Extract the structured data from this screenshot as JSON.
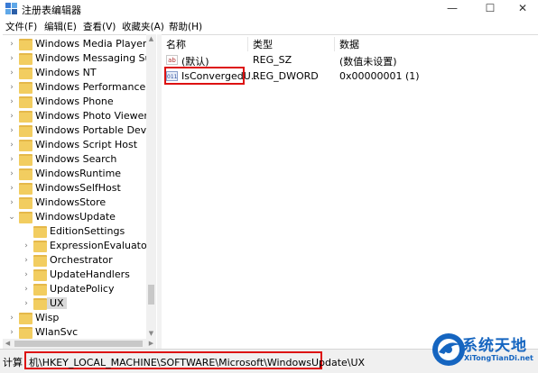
{
  "window": {
    "title": "注册表编辑器",
    "minimize_glyph": "—",
    "maximize_glyph": "☐",
    "close_glyph": "✕"
  },
  "menu": [
    "文件(F)",
    "编辑(E)",
    "查看(V)",
    "收藏夹(A)",
    "帮助(H)"
  ],
  "tree": [
    {
      "label": "Windows Media Player NS",
      "indent": 0,
      "expander": "collapsed"
    },
    {
      "label": "Windows Messaging Subs",
      "indent": 0,
      "expander": "collapsed"
    },
    {
      "label": "Windows NT",
      "indent": 0,
      "expander": "collapsed"
    },
    {
      "label": "Windows Performance Too",
      "indent": 0,
      "expander": "collapsed"
    },
    {
      "label": "Windows Phone",
      "indent": 0,
      "expander": "collapsed"
    },
    {
      "label": "Windows Photo Viewer",
      "indent": 0,
      "expander": "collapsed"
    },
    {
      "label": "Windows Portable Devices",
      "indent": 0,
      "expander": "collapsed"
    },
    {
      "label": "Windows Script Host",
      "indent": 0,
      "expander": "collapsed"
    },
    {
      "label": "Windows Search",
      "indent": 0,
      "expander": "collapsed"
    },
    {
      "label": "WindowsRuntime",
      "indent": 0,
      "expander": "collapsed"
    },
    {
      "label": "WindowsSelfHost",
      "indent": 0,
      "expander": "collapsed"
    },
    {
      "label": "WindowsStore",
      "indent": 0,
      "expander": "collapsed"
    },
    {
      "label": "WindowsUpdate",
      "indent": 0,
      "expander": "expanded"
    },
    {
      "label": "EditionSettings",
      "indent": 1,
      "expander": "none"
    },
    {
      "label": "ExpressionEvaluators",
      "indent": 1,
      "expander": "collapsed"
    },
    {
      "label": "Orchestrator",
      "indent": 1,
      "expander": "collapsed"
    },
    {
      "label": "UpdateHandlers",
      "indent": 1,
      "expander": "collapsed"
    },
    {
      "label": "UpdatePolicy",
      "indent": 1,
      "expander": "collapsed"
    },
    {
      "label": "UX",
      "indent": 1,
      "expander": "collapsed",
      "selected": true
    },
    {
      "label": "Wisp",
      "indent": 0,
      "expander": "collapsed"
    },
    {
      "label": "WlanSvc",
      "indent": 0,
      "expander": "collapsed"
    }
  ],
  "list": {
    "columns": [
      "名称",
      "类型",
      "数据"
    ],
    "rows": [
      {
        "icon": "string-value-icon",
        "icon_text": "ab",
        "name": "(默认)",
        "type": "REG_SZ",
        "data": "(数值未设置)"
      },
      {
        "icon": "dword-value-icon",
        "icon_text": "011",
        "name": "IsConvergedU...",
        "type": "REG_DWORD",
        "data": "0x00000001 (1)"
      }
    ]
  },
  "status": {
    "label": "计算",
    "path": "机\\HKEY_LOCAL_MACHINE\\SOFTWARE\\Microsoft\\WindowsUpdate\\UX"
  },
  "watermark": {
    "title": "系统天地",
    "subtitle": "XiTongTianDi.net"
  },
  "colors": {
    "highlight_border": "#d11111",
    "folder": "#f2cd60",
    "watermark": "#1565c0"
  }
}
